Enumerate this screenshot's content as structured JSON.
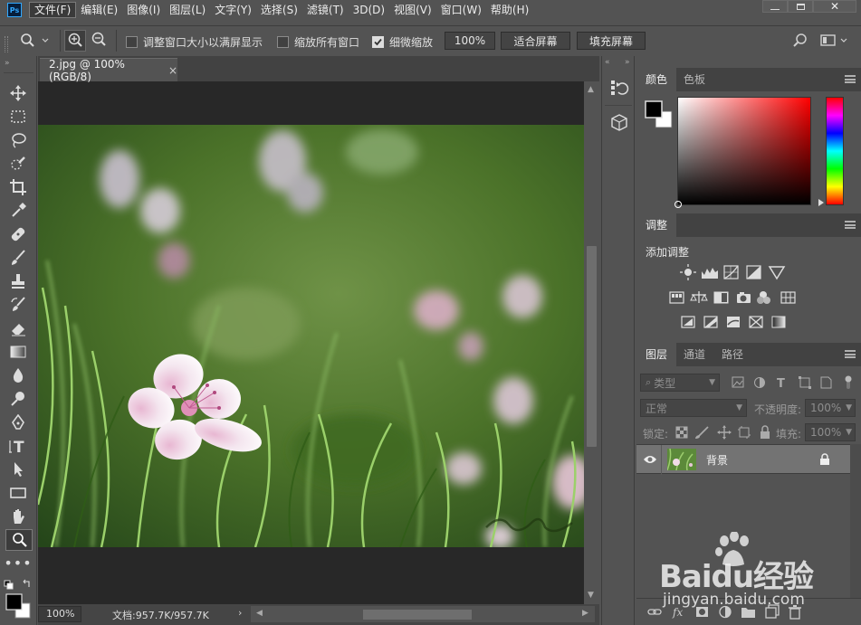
{
  "menubar": {
    "logo": "Ps",
    "items": [
      {
        "label": "文件(F)",
        "active": true
      },
      {
        "label": "编辑(E)"
      },
      {
        "label": "图像(I)"
      },
      {
        "label": "图层(L)"
      },
      {
        "label": "文字(Y)"
      },
      {
        "label": "选择(S)"
      },
      {
        "label": "滤镜(T)"
      },
      {
        "label": "3D(D)"
      },
      {
        "label": "视图(V)"
      },
      {
        "label": "窗口(W)"
      },
      {
        "label": "帮助(H)"
      }
    ]
  },
  "options": {
    "resize_windows_label": "调整窗口大小以满屏显示",
    "resize_windows_checked": false,
    "zoom_all_label": "缩放所有窗口",
    "zoom_all_checked": false,
    "scrubby_label": "细微缩放",
    "scrubby_checked": true,
    "zoom_value": "100%",
    "fit_screen_label": "适合屏幕",
    "fill_screen_label": "填充屏幕"
  },
  "document": {
    "tab_title": "2.jpg @ 100%(RGB/8)",
    "close_glyph": "×",
    "status_zoom": "100%",
    "status_doc": "文档:957.7K/957.7K",
    "status_arrow": "›"
  },
  "panels": {
    "color": {
      "tabs": [
        "颜色",
        "色板"
      ],
      "selected": 0
    },
    "adjustments": {
      "tab": "调整",
      "heading": "添加调整"
    },
    "layers": {
      "tabs": [
        "图层",
        "通道",
        "路径"
      ],
      "selected": 0,
      "filter_label": "类型",
      "blend_mode": "正常",
      "opacity_label": "不透明度:",
      "opacity_value": "100%",
      "lock_label": "锁定:",
      "fill_label": "填充:",
      "fill_value": "100%",
      "layer_name": "背景"
    }
  },
  "watermark": {
    "brand": "Baidu经验",
    "url": "jingyan.baidu.com"
  },
  "colors": {
    "ui_bg": "#535353",
    "panel_header": "#424242",
    "canvas_bg": "#282828",
    "foreground": "#000000",
    "background": "#ffffff"
  }
}
